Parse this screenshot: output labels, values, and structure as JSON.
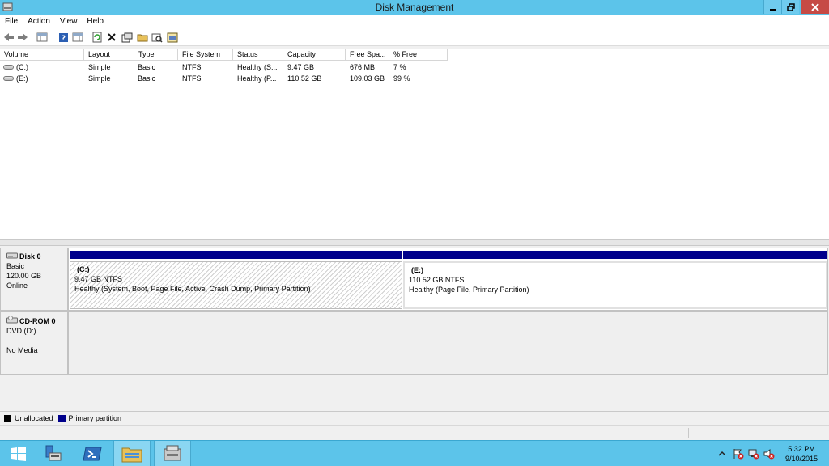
{
  "window": {
    "title": "Disk Management"
  },
  "menu": [
    "File",
    "Action",
    "View",
    "Help"
  ],
  "toolbar": {
    "buttons": [
      "back-icon",
      "forward-icon",
      "show-hide-console-tree-icon",
      "help-icon",
      "properties-pane-icon",
      "refresh-icon",
      "delete-icon",
      "properties-icon",
      "open-icon",
      "explore-icon",
      "rescan-icon"
    ]
  },
  "volume_table": {
    "columns": [
      "Volume",
      "Layout",
      "Type",
      "File System",
      "Status",
      "Capacity",
      "Free Spa...",
      "% Free"
    ],
    "rows": [
      {
        "volume": "(C:)",
        "layout": "Simple",
        "type": "Basic",
        "fs": "NTFS",
        "status": "Healthy (S...",
        "capacity": "9.47 GB",
        "free": "676 MB",
        "pct": "7 %"
      },
      {
        "volume": "(E:)",
        "layout": "Simple",
        "type": "Basic",
        "fs": "NTFS",
        "status": "Healthy (P...",
        "capacity": "110.52 GB",
        "free": "109.03 GB",
        "pct": "99 %"
      }
    ]
  },
  "disks": {
    "disk0": {
      "name": "Disk 0",
      "type": "Basic",
      "size": "120.00 GB",
      "state": "Online",
      "partitions": [
        {
          "label": "(C:)",
          "size": "9.47 GB NTFS",
          "status": "Healthy (System, Boot, Page File, Active, Crash Dump, Primary Partition)"
        },
        {
          "label": "(E:)",
          "size": "110.52 GB NTFS",
          "status": "Healthy (Page File, Primary Partition)"
        }
      ]
    },
    "cdrom0": {
      "name": "CD-ROM 0",
      "drive": "DVD (D:)",
      "media": "No Media"
    }
  },
  "legend": [
    {
      "label": "Unallocated",
      "color": "#000000"
    },
    {
      "label": "Primary partition",
      "color": "#00008b"
    }
  ],
  "taskbar": {
    "clock_time": "5:32 PM",
    "clock_date": "9/10/2015",
    "apps": [
      "start-icon",
      "server-manager-icon",
      "powershell-icon",
      "file-explorer-icon",
      "disk-management-icon"
    ]
  },
  "colors": {
    "titlebar": "#5cc4ea",
    "primary_partition": "#00008b",
    "close_button": "#c64a45"
  }
}
